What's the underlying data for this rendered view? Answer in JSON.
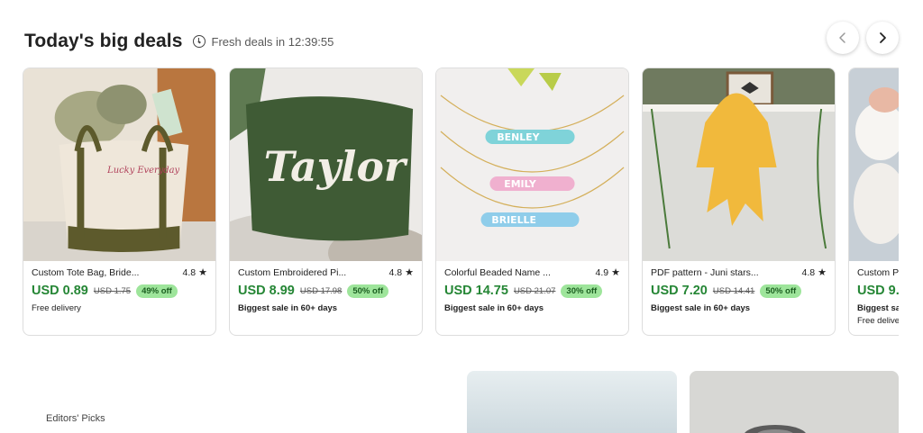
{
  "header": {
    "title": "Today's big deals",
    "timer_text": "Fresh deals in 12:39:55"
  },
  "nav": {
    "prev_icon": "chevron-left-icon",
    "next_icon": "chevron-right-icon"
  },
  "cards": [
    {
      "name": "Custom Tote Bag, Bride...",
      "rating": "4.8",
      "price": "USD 0.89",
      "original_price": "USD 1.75",
      "discount": "49% off",
      "note": "Free delivery",
      "note2": ""
    },
    {
      "name": "Custom Embroidered Pi...",
      "rating": "4.8",
      "price": "USD 8.99",
      "original_price": "USD 17.98",
      "discount": "50% off",
      "note": "Biggest sale in 60+ days",
      "note2": ""
    },
    {
      "name": "Colorful Beaded Name ...",
      "rating": "4.9",
      "price": "USD 14.75",
      "original_price": "USD 21.07",
      "discount": "30% off",
      "note": "Biggest sale in 60+ days",
      "note2": ""
    },
    {
      "name": "PDF pattern - Juni stars...",
      "rating": "4.8",
      "price": "USD 7.20",
      "original_price": "USD 14.41",
      "discount": "50% off",
      "note": "Biggest sale in 60+ days",
      "note2": ""
    },
    {
      "name": "Custom P",
      "rating": "",
      "price": "USD 9.(",
      "original_price": "",
      "discount": "",
      "note": "Biggest sa",
      "note2": "Free delive"
    }
  ],
  "images": {
    "tote_text": "Lucky Everyday",
    "pillow_text": "Taylor",
    "beads_line1": "BENLEY",
    "beads_line2": "EMILY",
    "beads_line3": "BRIELLE"
  },
  "section": {
    "editors_picks": "Editors' Picks"
  },
  "colors": {
    "price_green": "#258635",
    "badge_bg": "#9ee59b",
    "text": "#222222"
  }
}
